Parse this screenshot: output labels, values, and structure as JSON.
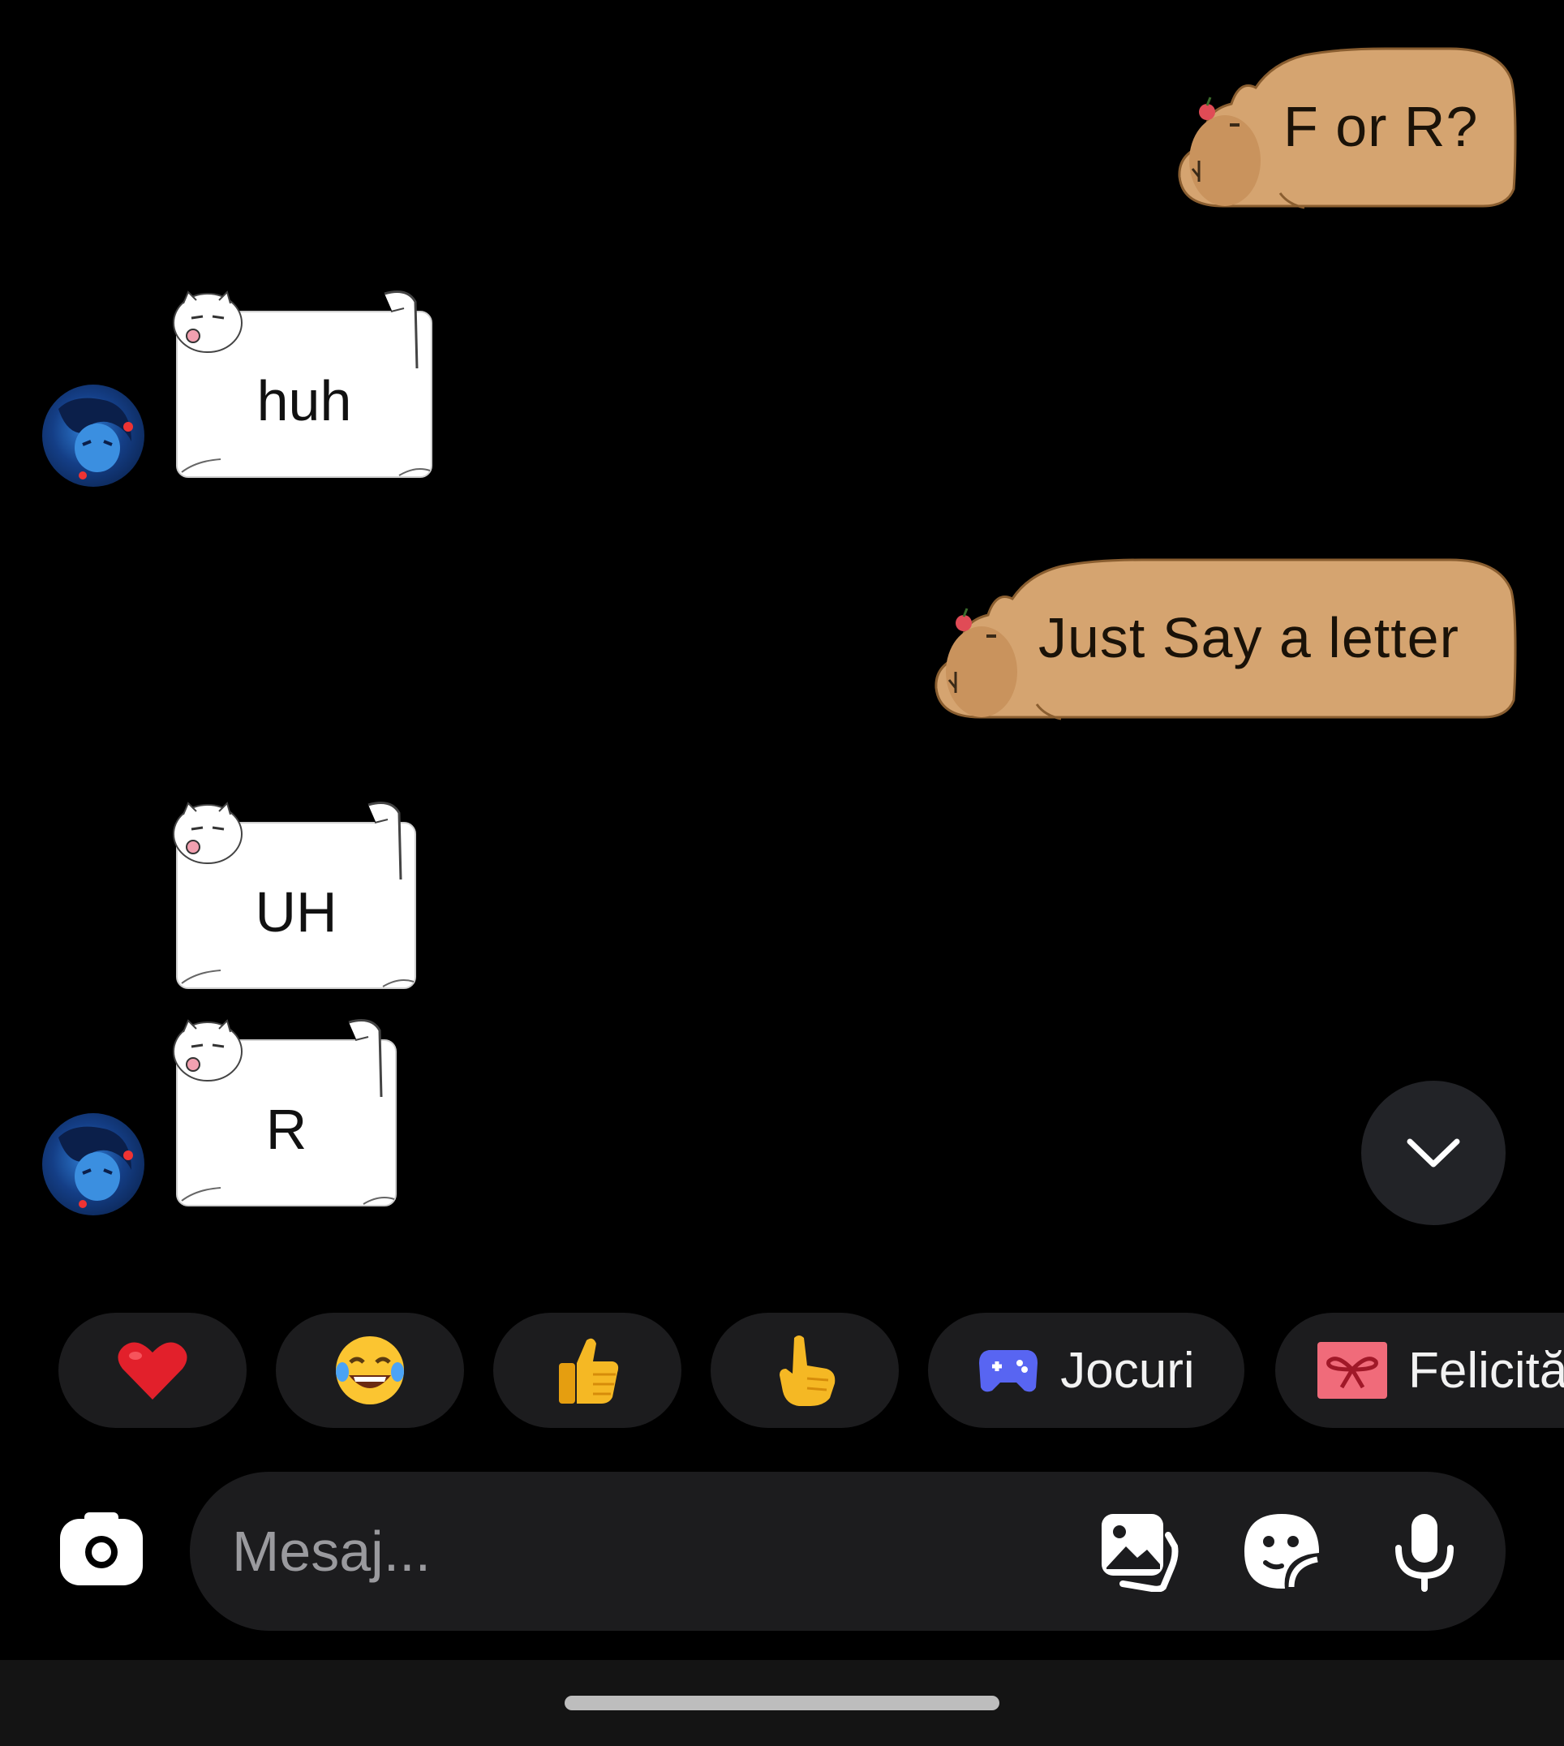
{
  "messages": [
    {
      "sender": "me",
      "style": "capybara-bubble",
      "text": "F or R?"
    },
    {
      "sender": "other",
      "style": "cat-bubble",
      "text": "huh"
    },
    {
      "sender": "me",
      "style": "capybara-bubble",
      "text": "Just Say a letter"
    },
    {
      "sender": "other",
      "style": "cat-bubble",
      "text": "UH"
    },
    {
      "sender": "other",
      "style": "cat-bubble",
      "text": "R"
    }
  ],
  "quick_replies": [
    {
      "emoji": "❤️",
      "icon": "heart-icon"
    },
    {
      "emoji": "😂",
      "icon": "laughing-face-icon"
    },
    {
      "emoji": "👍",
      "icon": "thumbs-up-icon"
    },
    {
      "emoji": "👆",
      "icon": "pointing-hand-icon"
    },
    {
      "icon": "gamepad-icon",
      "label": "Jocuri"
    },
    {
      "icon": "gift-ribbon-icon",
      "label": "Felicită"
    }
  ],
  "composer": {
    "placeholder": "Mesaj..."
  },
  "colors": {
    "background": "#000000",
    "capybara_bubble": "#d5a470",
    "cat_bubble": "#ffffff",
    "chip_background": "#1c1c1e",
    "placeholder_text": "#9a9a9e",
    "gamepad": "#5865f2",
    "gift": "#f06b7a"
  },
  "icons": {
    "scroll_down": "chevron-down-icon",
    "camera": "camera-icon",
    "gallery": "gallery-icon",
    "sticker": "sticker-icon",
    "microphone": "microphone-icon"
  }
}
